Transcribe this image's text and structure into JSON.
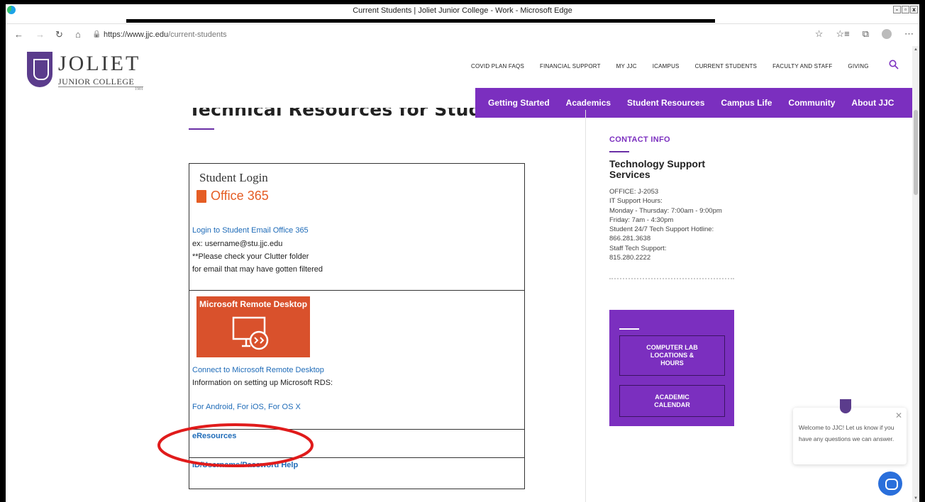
{
  "window": {
    "title": "Current Students | Joliet Junior College - Work - Microsoft Edge",
    "controls": [
      "-",
      "▫",
      "x"
    ]
  },
  "browser": {
    "url_host": "https://www.jjc.edu",
    "url_path": "/current-students",
    "nav_back": "←",
    "nav_forward": "→",
    "nav_refresh": "↻",
    "nav_home": "⌂",
    "lock_icon": "🔒",
    "right_icons": [
      "☆",
      "☆≡",
      "⧉",
      "⋯"
    ]
  },
  "logo": {
    "name_line1": "JOLIET",
    "name_line2": "JUNIOR COLLEGE",
    "year": "1901"
  },
  "top_nav": [
    "COVID PLAN FAQS",
    "FINANCIAL SUPPORT",
    "MY JJC",
    "ICAMPUS",
    "CURRENT STUDENTS",
    "FACULTY AND STAFF",
    "GIVING"
  ],
  "main_nav": [
    "Getting Started",
    "Academics",
    "Student Resources",
    "Campus Life",
    "Community",
    "About JJC"
  ],
  "page_heading": "Technical Resources for Students",
  "resources": {
    "office": {
      "student_login": "Student Login",
      "office_logo_text": "Office 365",
      "login_link": "Login to Student Email Office 365",
      "example": "ex: username@stu.jjc.edu",
      "note1": "**Please check your  Clutter folder",
      "note2": "for email that may have gotten filtered"
    },
    "rds": {
      "image_title": "Microsoft Remote Desktop",
      "connect_link": "Connect to Microsoft Remote Desktop",
      "info": "Information on setting up Microsoft RDS:",
      "platform_links": "For Android, For iOS, For OS X"
    },
    "eresources": "eResources",
    "id_help": "ID/Username/Password Help"
  },
  "contact": {
    "heading": "CONTACT INFO",
    "dept_line1": "Technology Support",
    "dept_line2": "Services",
    "lines": [
      "OFFICE: J-2053",
      "IT Support Hours:",
      "Monday - Thursday: 7:00am - 9:00pm",
      "Friday: 7am - 4:30pm",
      "Student 24/7 Tech Support Hotline:",
      "866.281.3638",
      "Staff Tech Support:",
      "815.280.2222"
    ]
  },
  "quicklinks": {
    "lab_line1": "COMPUTER LAB",
    "lab_line2": "LOCATIONS &",
    "lab_line3": "HOURS",
    "cal_line1": "ACADEMIC",
    "cal_line2": "CALENDAR"
  },
  "chat": {
    "message": "Welcome to JJC! Let us know if you have any questions we can answer.",
    "close": "✕"
  },
  "colors": {
    "brand_purple": "#7b2fbf",
    "link_blue": "#1e6bb8",
    "office_orange": "#e55d24",
    "rds_orange": "#d9512c",
    "annotation_red": "#e01b1b"
  }
}
